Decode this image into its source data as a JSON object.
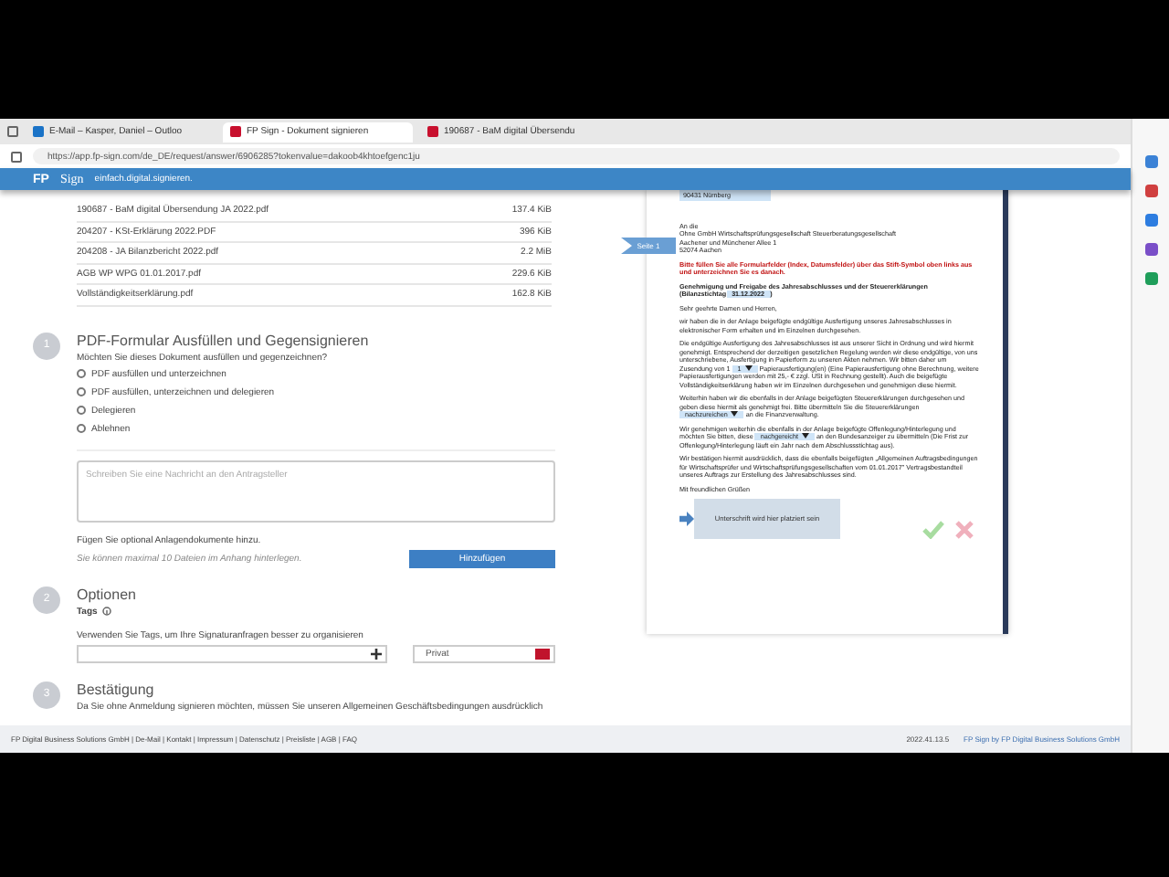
{
  "browser": {
    "tabs": [
      {
        "label": "E-Mail – Kasper, Daniel – Outloo",
        "selected": false
      },
      {
        "label": "FP Sign - Dokument signieren",
        "selected": true
      },
      {
        "label": "190687 - BaM digital Übersendu",
        "selected": false
      }
    ],
    "address": "https://app.fp-sign.com/de_DE/request/answer/6906285?tokenvalue=dakoob4khtoefgenc1ju"
  },
  "header": {
    "logo": "FP",
    "logo_word": "Sign",
    "tagline": "einfach.digital.signieren."
  },
  "files": [
    {
      "name": "190687 - BaM digital Übersendung JA 2022.pdf",
      "size": "137.4 KiB"
    },
    {
      "name": "204207 - KSt-Erklärung 2022.PDF",
      "size": "396 KiB"
    },
    {
      "name": "204208 - JA Bilanzbericht 2022.pdf",
      "size": "2.2 MiB"
    },
    {
      "name": "AGB WP WPG 01.01.2017.pdf",
      "size": "229.6 KiB"
    },
    {
      "name": "Vollständigkeitserklärung.pdf",
      "size": "162.8 KiB"
    }
  ],
  "step1": {
    "number": "1",
    "title": "PDF-Formular Ausfüllen und Gegensignieren",
    "question": "Möchten Sie dieses Dokument ausfüllen und gegenzeichnen?",
    "options": [
      {
        "label": "PDF ausfüllen und unterzeichnen",
        "selected": false
      },
      {
        "label": "PDF ausfüllen, unterzeichnen und delegieren",
        "selected": false
      },
      {
        "label": "Delegieren",
        "selected": false
      },
      {
        "label": "Ablehnen",
        "selected": false
      }
    ],
    "message": {
      "placeholder": "Schreiben Sie eine Nachricht an den Antragsteller"
    },
    "attach_label": "Fügen Sie optional Anlagendokumente hinzu.",
    "attach_hint": "Sie können maximal 10 Dateien im Anhang hinterlegen.",
    "add_button": "Hinzufügen"
  },
  "step2": {
    "number": "2",
    "title": "Optionen",
    "tags_label": "Tags",
    "tags_hint": "Verwenden Sie Tags, um Ihre Signaturanfragen besser zu organisieren",
    "tag_select": {
      "value": "Privat",
      "color": "#c0142c"
    }
  },
  "step3": {
    "number": "3",
    "title": "Bestätigung",
    "text": "Da Sie ohne Anmeldung signieren möchten, müssen Sie unseren Allgemeinen Geschäftsbedingungen ausdrücklich"
  },
  "document": {
    "page_flag": "Seite 1",
    "sender_line": "90431 Nürnberg",
    "address": [
      "An die",
      "Ohne GmbH Wirtschaftsprüfungsgesellschaft Steuerberatungsgesellschaft",
      "Aachener und Münchener Allee 1",
      "52074 Aachen"
    ],
    "notice": "Bitte füllen Sie alle Formularfelder (Index, Datumsfelder) über das Stift-Symbol oben links aus und unterzeichnen Sie es danach.",
    "subject": "Genehmigung und Freigabe des Jahresabschlusses und der Steuererklärungen (Bilanzstichtag",
    "subject_field": "31.12.2022",
    "subject_end": ")",
    "salutation": "Sehr geehrte Damen und Herren,",
    "p1": "wir haben die in der Anlage beigefügte endgültige Ausfertigung unseres Jahresabschlusses in elektronischer Form erhalten und im Einzelnen durchgesehen.",
    "p2a": "Die endgültige Ausfertigung des Jahresabschlusses ist aus unserer Sicht in Ordnung und wird hiermit genehmigt. Entsprechend der derzeitigen gesetzlichen Regelung werden wir diese endgültige, von uns unterschriebene, Ausfertigung in Papierform zu unseren Akten nehmen. Wir bitten daher um Zusendung von 1",
    "p2_field": "1",
    "p2b": "Papierausfertigung(en) (Eine Papierausfertigung ohne Berechnung, weitere Papierausfertigungen werden mit 25,- € zzgl. USt in Rechnung gestellt). Auch die beigefügte Vollständigkeitserklärung haben wir im Einzelnen durchgesehen und genehmigen diese hiermit.",
    "p3a": "Weiterhin haben wir die ebenfalls in der Anlage beigefügten Steuererklärungen durchgesehen und geben diese hiermit als genehmigt frei. Bitte übermitteln Sie die Steuererklärungen",
    "p3_field": "nachzureichen",
    "p3b": "an die Finanzverwaltung.",
    "p4a": "Wir genehmigen weiterhin die ebenfalls in der Anlage beigefügte Offenlegung/Hinterlegung und möchten Sie bitten, diese",
    "p4_field": "nachgereicht",
    "p4b": "an den Bundesanzeiger zu übermitteln (Die Frist zur Offenlegung/Hinterlegung läuft ein Jahr nach dem Abschlussstichtag aus).",
    "p5": "Wir bestätigen hiermit ausdrücklich, dass die ebenfalls beigefügten „Allgemeinen Auftragsbedingungen für Wirtschaftsprüfer und Wirtschaftsprüfungsgesellschaften vom 01.01.2017\" Vertragsbestandteil unseres Auftrags zur Erstellung des Jahresabschlusses sind.",
    "closing": "Mit freundlichen Grüßen",
    "signature": "Unterschrift wird hier platziert sein"
  },
  "footer": {
    "links": "FP Digital Business Solutions GmbH | De-Mail | Kontakt | Impressum | Datenschutz | Preisliste | AGB | FAQ",
    "version": "2022.41.13.5",
    "brand": "FP Sign by FP Digital Business Solutions GmbH"
  }
}
